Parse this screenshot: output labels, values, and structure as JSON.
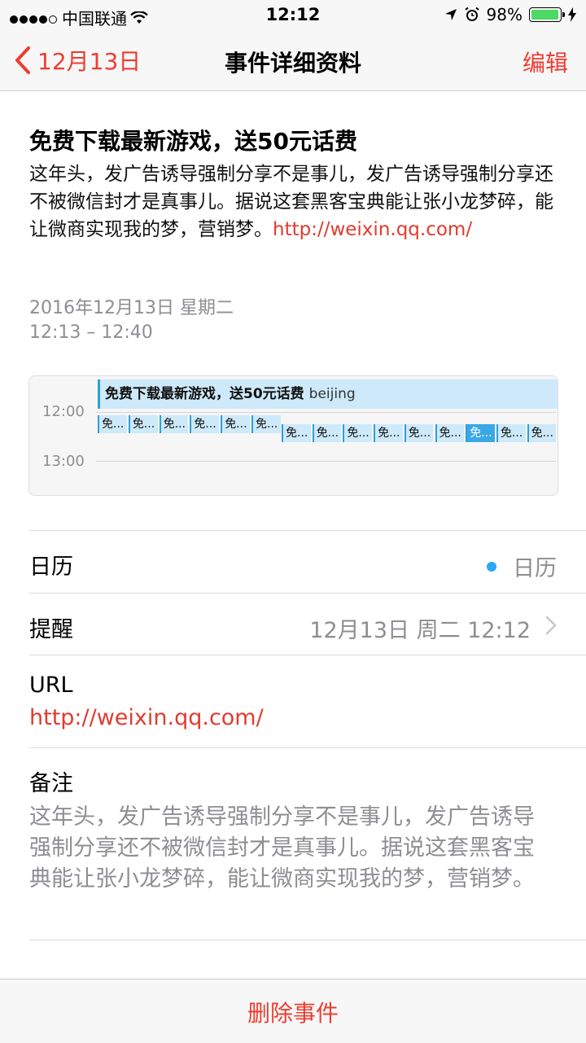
{
  "status_bar": {
    "carrier": "中国联通",
    "time": "12:12",
    "battery": "98%"
  },
  "nav": {
    "back_label": "12月13日",
    "title": "事件详细资料",
    "edit_label": "编辑"
  },
  "event": {
    "title": "免费下载最新游戏，送50元话费",
    "description": "这年头，发广告诱导强制分享不是事儿，发广告诱导强制分享还不被微信封才是真事儿。据说这套黑客宝典能让张小龙梦碎，能让微商实现我的梦，营销梦。",
    "description_link": "http://weixin.qq.com/",
    "date": "2016年12月13日 星期二",
    "time_range": "12:13 – 12:40"
  },
  "day_view": {
    "hour_labels": [
      "12:00",
      "13:00"
    ],
    "main_event_title": "免费下载最新游戏，送50元话费",
    "main_event_location": "beijing",
    "mini_label": "免...",
    "mini_count_row1": 6,
    "mini_count_row2": 9,
    "selected_mini_index": 6
  },
  "rows": {
    "calendar_label": "日历",
    "calendar_value": "日历",
    "calendar_color": "#2aa7f5",
    "reminder_label": "提醒",
    "reminder_value": "12月13日 周二 12:12",
    "url_label": "URL",
    "url_value": "http://weixin.qq.com/",
    "notes_label": "备注",
    "notes_text": "这年头，发广告诱导强制分享不是事儿，发广告诱导强制分享还不被微信封才是真事儿。据说这套黑客宝典能让张小龙梦碎，能让微商实现我的梦，营销梦。"
  },
  "footer": {
    "delete_label": "删除事件"
  },
  "colors": {
    "accent": "#ef3c30",
    "link": "#e23b2e",
    "event_fill": "#cde9fa",
    "event_border": "#2ea0dc"
  }
}
